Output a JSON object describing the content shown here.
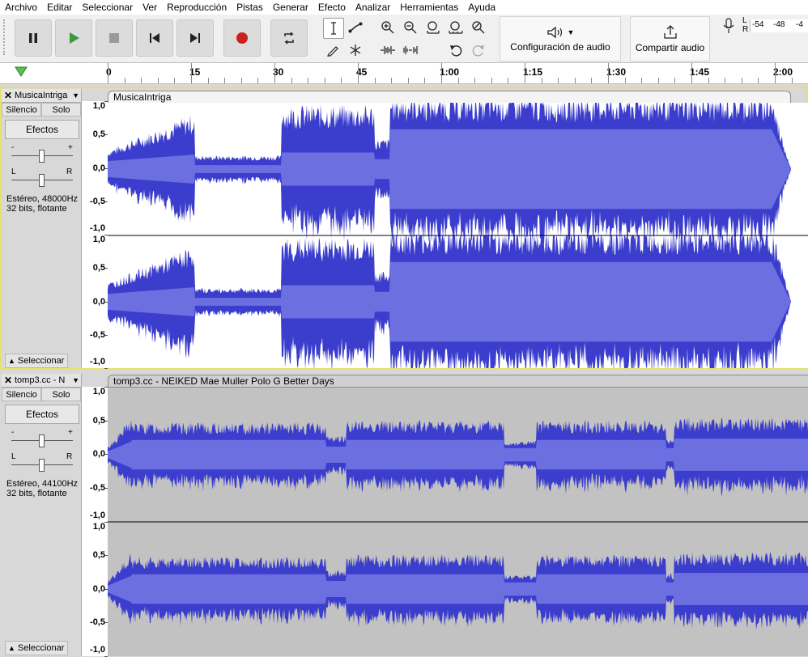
{
  "menu": [
    "Archivo",
    "Editar",
    "Seleccionar",
    "Ver",
    "Reproducción",
    "Pistas",
    "Generar",
    "Efecto",
    "Analizar",
    "Herramientas",
    "Ayuda"
  ],
  "toolbar": {
    "audio_setup_label": "Configuración de audio",
    "share_audio_label": "Compartir audio",
    "meter_ticks": [
      "-54",
      "-48",
      "-4"
    ],
    "meter_lr": [
      "L",
      "R"
    ]
  },
  "ruler": {
    "ticks": [
      "0",
      "15",
      "30",
      "45",
      "1:00",
      "1:15",
      "1:30",
      "1:45",
      "2:00"
    ]
  },
  "tracks": [
    {
      "name": "MusicaIntriga",
      "clip_title": "MusicaIntriga",
      "mute": "Silencio",
      "solo": "Solo",
      "effects": "Efectos",
      "info1": "Estéreo, 48000Hz",
      "info2": "32 bits, flotante",
      "select": "Seleccionar",
      "scale": [
        "1,0",
        "0,5",
        "0,0",
        "-0,5",
        "-1,0"
      ],
      "selected": true
    },
    {
      "name": "tomp3.cc - N",
      "clip_title": "tomp3.cc - NEIKED Mae Muller Polo G  Better Days",
      "mute": "Silencio",
      "solo": "Solo",
      "effects": "Efectos",
      "info1": "Estéreo, 44100Hz",
      "info2": "32 bits, flotante",
      "select": "Seleccionar",
      "scale": [
        "1,0",
        "0,5",
        "0,0",
        "-0,5",
        "-1,0"
      ],
      "selected": false
    }
  ],
  "slider_labels": {
    "minus": "-",
    "plus": "+",
    "left": "L",
    "right": "R"
  },
  "colors": {
    "wave_peak": "#3b3dcc",
    "wave_rms": "#6c6fe0",
    "sel_bg": "#ffffff",
    "unsel_bg": "#c2c2c2",
    "track_sel_border": "#e8e26a"
  }
}
